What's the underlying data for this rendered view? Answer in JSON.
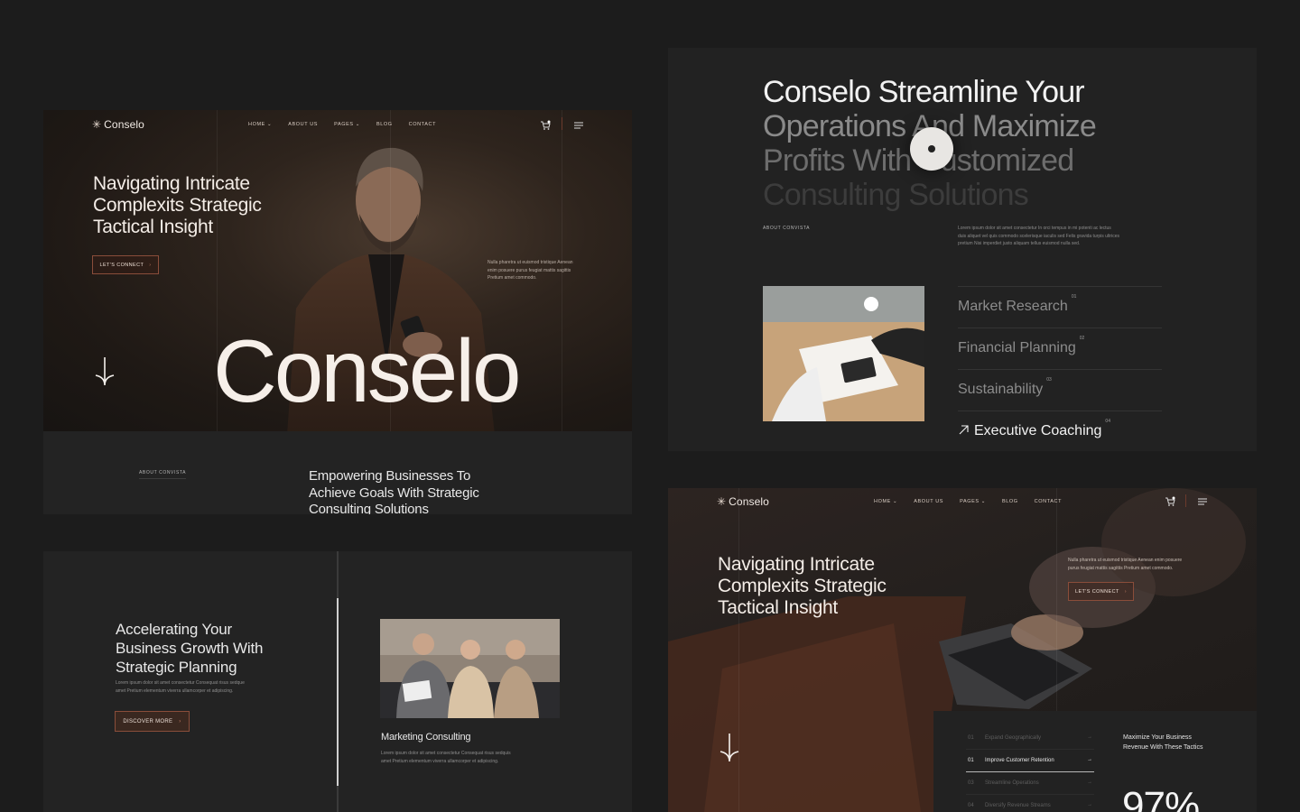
{
  "panel_a": {
    "logo": "Conselo",
    "nav": [
      "HOME ⌄",
      "ABOUT US",
      "PAGES ⌄",
      "BLOG",
      "CONTACT"
    ],
    "headline": [
      "Navigating Intricate",
      "Complexits Strategic",
      "Tactical Insight"
    ],
    "cta": "LET'S CONNECT",
    "side_text": [
      "Nulla pharetra ut euismod tristique Aenean",
      "enim posuere purus feugiat mattis sagittis",
      "Pretium amet commodo."
    ],
    "big_word": "Conselo"
  },
  "panel_a2": {
    "tag": "ABOUT CONVISTA",
    "heading": [
      "Empowering Businesses To",
      "Achieve Goals With Strategic",
      "Consulting Solutions"
    ]
  },
  "panel_c": {
    "heading": [
      "Accelerating Your",
      "Business Growth With",
      "Strategic Planning"
    ],
    "body": [
      "Lorem ipsum dolor sit amet consectetur Consequat risus sedque",
      "amet Pretium elementum viverra ullamcorper et adipiscing."
    ],
    "button": "DISCOVER MORE",
    "card_title": "Marketing Consulting",
    "card_body": [
      "Lorem ipsum dolor sit amet consectetur Consequat risus sedquis",
      "amet Pretium elementum viverra ullamcorper et adipiscing."
    ]
  },
  "panel_b": {
    "heading": [
      "Conselo Streamline Your",
      "Operations And Maximize",
      "Profits With Customized",
      "Consulting Solutions"
    ],
    "tag": "ABOUT CONVISTA",
    "body": [
      "Lorem ipsum dolor sit amet consectetur In orci tempus in mi potenti ac lectus",
      "duis aliquet vel quis commodo scelerisque iaculis sed Felis gravida turpis ultrices",
      "pretium Nisi imperdiet justo aliquam tellus euismod nulla sed."
    ],
    "services": [
      {
        "label": "Market Research",
        "num": "01"
      },
      {
        "label": "Financial Planning",
        "num": "02"
      },
      {
        "label": "Sustainability",
        "num": "03"
      },
      {
        "label": "Executive Coaching",
        "num": "04"
      }
    ]
  },
  "panel_d": {
    "logo": "Conselo",
    "nav": [
      "HOME ⌄",
      "ABOUT US",
      "PAGES ⌄",
      "BLOG",
      "CONTACT"
    ],
    "headline": [
      "Navigating Intricate",
      "Complexits Strategic",
      "Tactical Insight"
    ],
    "side_text": [
      "Nulla pharetra ut euismod tristique Aenean enim posuere",
      "purus feugiat mattis sagittis Pretium amet commodo."
    ],
    "cta": "LET'S CONNECT",
    "list": [
      {
        "num": "01",
        "label": "Expand Geographically"
      },
      {
        "num": "01",
        "label": "Improve Customer Retention"
      },
      {
        "num": "03",
        "label": "Streamline Operations"
      },
      {
        "num": "04",
        "label": "Diversify Revenue Streams"
      }
    ],
    "maximize": [
      "Maximize Your Business",
      "Revenue With These Tactics"
    ],
    "stat": "97%"
  },
  "colors": {
    "accent": "#8a4d3a",
    "bg": "#1c1c1c",
    "panel": "#232323"
  },
  "icons": [
    "cart-icon",
    "menu-icon",
    "arrow-down-icon",
    "arrow-up-right-icon",
    "asterisk-logo-icon"
  ]
}
